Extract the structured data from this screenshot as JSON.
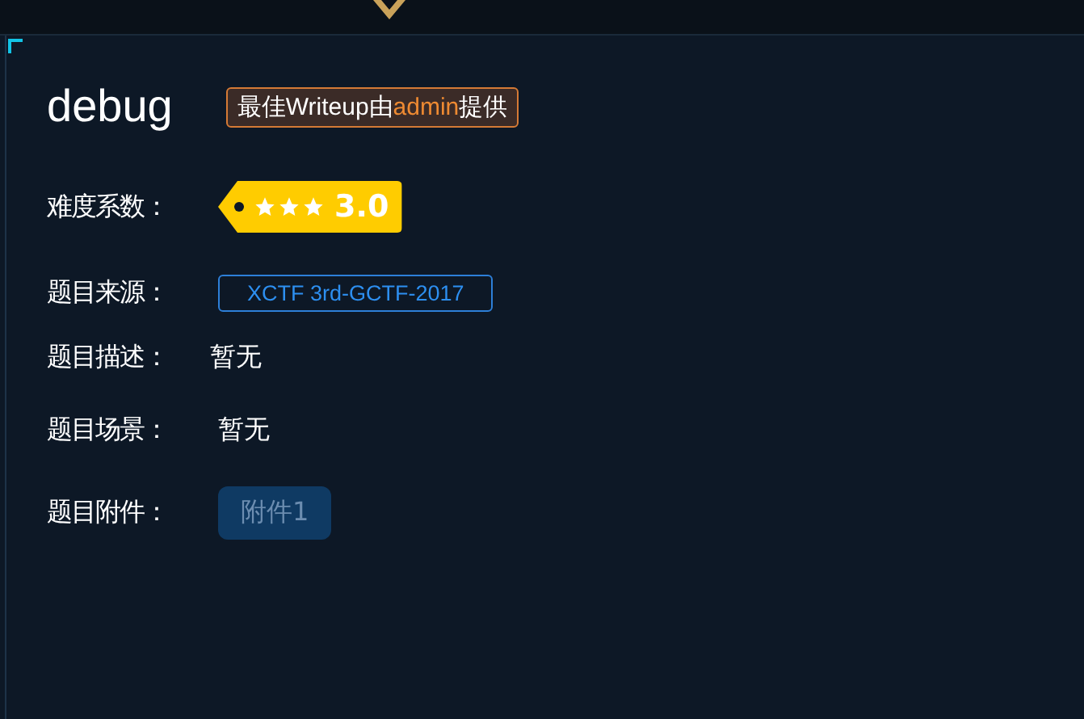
{
  "title": "debug",
  "writeup_badge": {
    "text": "最佳Writeup由**admin**提供"
  },
  "difficulty": {
    "label": "难度系数：",
    "stars": 3,
    "score": "3.0"
  },
  "source": {
    "label": "题目来源：",
    "value": "XCTF 3rd-GCTF-2017"
  },
  "description": {
    "label": "题目描述：",
    "value": "暂无"
  },
  "scene": {
    "label": "题目场景：",
    "value": "暂无"
  },
  "attachment": {
    "label": "题目附件：",
    "button": "附件1"
  }
}
